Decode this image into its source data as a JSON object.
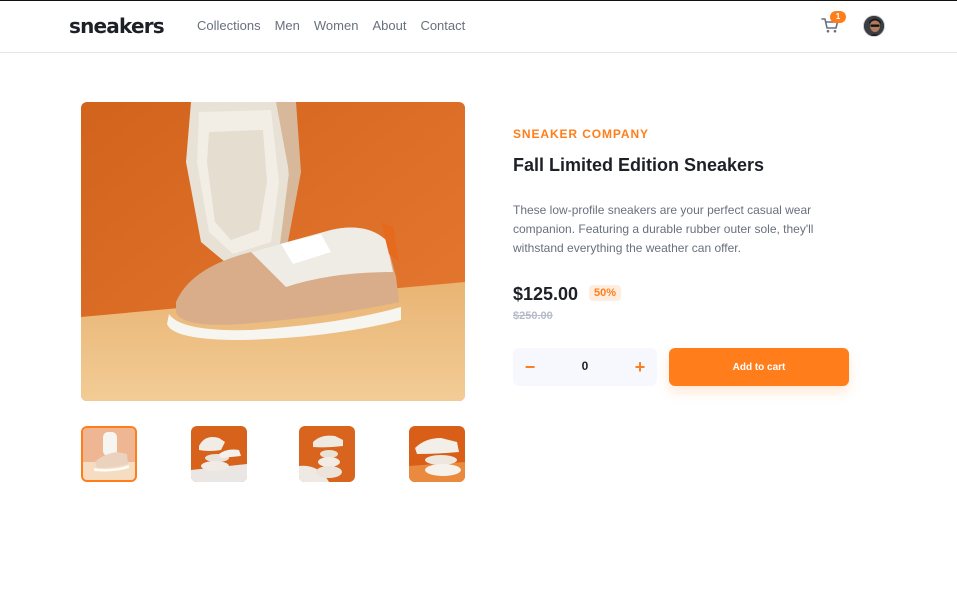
{
  "header": {
    "logo": "sneakers",
    "nav": [
      "Collections",
      "Men",
      "Women",
      "About",
      "Contact"
    ],
    "cart_count": "1",
    "cart_icon": "cart-icon",
    "avatar_icon": "avatar-image"
  },
  "product": {
    "company": "SNEAKER COMPANY",
    "title": "Fall Limited Edition Sneakers",
    "description": "These low-profile sneakers are your perfect casual wear companion. Featuring a durable rubber outer sole, they'll withstand everything the weather can offer.",
    "price": "$125.00",
    "discount": "50%",
    "original_price": "$250.00"
  },
  "purchase": {
    "minus_label": "−",
    "quantity": "0",
    "plus_label": "+",
    "add_to_cart": "Add to cart"
  },
  "colors": {
    "accent": "#ff7e1b",
    "accent_pale": "#ffede0",
    "text_dark": "#1d2026",
    "text_grey": "#69707d"
  }
}
